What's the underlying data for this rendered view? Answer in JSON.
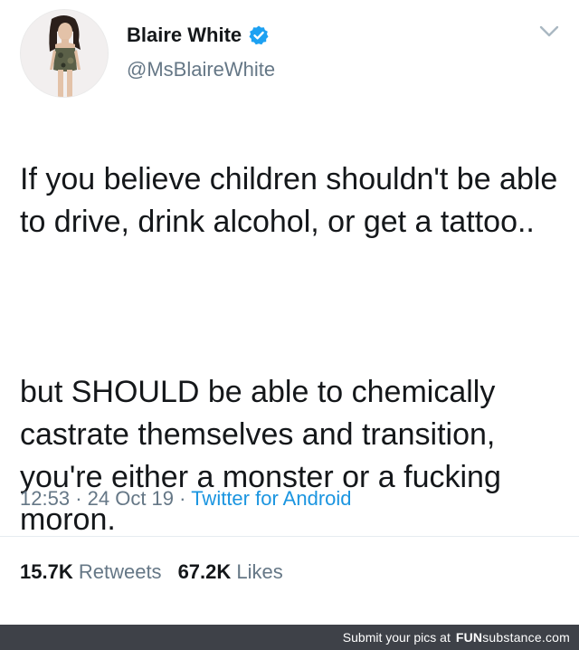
{
  "tweet": {
    "display_name": "Blaire White",
    "handle": "@MsBlaireWhite",
    "verified": true,
    "paragraphs": [
      "If you believe children shouldn't be able to drive, drink alcohol, or get a tattoo..",
      "but SHOULD be able to chemically castrate themselves and transition, you're either a monster or a fucking moron."
    ],
    "time": "12:53",
    "date": "24 Oct 19",
    "source": "Twitter for Android",
    "retweets_count": "15.7K",
    "retweets_label": "Retweets",
    "likes_count": "67.2K",
    "likes_label": "Likes"
  },
  "footer": {
    "prompt": "Submit your pics at",
    "brand_strong": "FUN",
    "brand_rest": "substance",
    "brand_suffix": ".com"
  },
  "colors": {
    "text": "#14171a",
    "muted": "#657786",
    "link": "#1b95e0",
    "verified": "#1da1f2",
    "footer_bg": "#3e4148"
  },
  "icons": [
    "verified-badge-icon",
    "chevron-down-icon"
  ]
}
